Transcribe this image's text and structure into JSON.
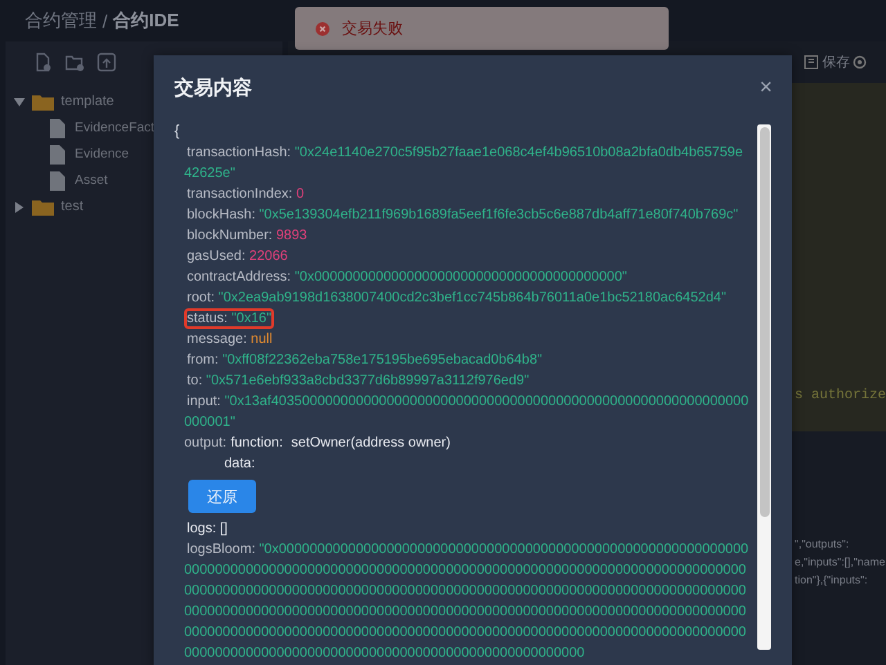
{
  "breadcrumb": {
    "items": [
      "合约管理",
      "合约IDE"
    ],
    "separator": "/"
  },
  "toast": {
    "kind": "error",
    "message": "交易失败"
  },
  "sidebar": {
    "tree": [
      {
        "label": "template",
        "kind": "folder",
        "expanded": true,
        "children": [
          {
            "label": "EvidenceFact",
            "kind": "file"
          },
          {
            "label": "Evidence",
            "kind": "file"
          },
          {
            "label": "Asset",
            "kind": "file"
          }
        ]
      },
      {
        "label": "test",
        "kind": "folder",
        "expanded": false
      }
    ]
  },
  "editor_toolbar": [
    {
      "label": "保存"
    }
  ],
  "editor": {
    "code_fragment": "s authorize"
  },
  "output_fragments": [
    "\",\"outputs\":",
    "e,\"inputs\":[],\"name",
    "tion\"},{\"inputs\":"
  ],
  "modal": {
    "title": "交易内容",
    "close": "×",
    "open_brace": "{",
    "fields": [
      {
        "key": "transactionHash:",
        "value": "\"0x24e1140e270c5f95b27faae1e068c4ef4b96510b08a2bfa0db4b65759e42625e\"",
        "kind": "string",
        "highlighted": false
      },
      {
        "key": "transactionIndex:",
        "value": "0",
        "kind": "number",
        "highlighted": false
      },
      {
        "key": "blockHash:",
        "value": "\"0x5e139304efb211f969b1689fa5eef1f6fe3cb5c6e887db4aff71e80f740b769c\"",
        "kind": "string",
        "highlighted": false
      },
      {
        "key": "blockNumber:",
        "value": "9893",
        "kind": "number",
        "highlighted": false
      },
      {
        "key": "gasUsed:",
        "value": "22066",
        "kind": "number",
        "highlighted": false
      },
      {
        "key": "contractAddress:",
        "value": "\"0x0000000000000000000000000000000000000000\"",
        "kind": "string",
        "highlighted": false
      },
      {
        "key": "root:",
        "value": "\"0x2ea9ab9198d1638007400cd2c3bef1cc745b864b76011a0e1bc52180ac6452d4\"",
        "kind": "string",
        "highlighted": false
      },
      {
        "key": "status:",
        "value": "\"0x16\"",
        "kind": "string",
        "highlighted": true
      },
      {
        "key": "message:",
        "value": "null",
        "kind": "null",
        "highlighted": false
      },
      {
        "key": "from:",
        "value": "\"0xff08f22362eba758e175195be695ebacad0b64b8\"",
        "kind": "string",
        "highlighted": false
      },
      {
        "key": "to:",
        "value": "\"0x571e6ebf933a8cbd3377d6b89997a3112f976ed9\"",
        "kind": "string",
        "highlighted": false
      },
      {
        "key": "input:",
        "value": "\"0x13af40350000000000000000000000000000000000000000000000000000000000000001\"",
        "kind": "string",
        "highlighted": false
      },
      {
        "key": "output:",
        "kind": "output",
        "function_label": "function:",
        "function": "setOwner(address owner)",
        "data_label": "data:",
        "button": "还原"
      },
      {
        "key": "logs:",
        "value": "[]",
        "kind": "plain",
        "highlighted": false
      },
      {
        "key": "logsBloom:",
        "value": "\"0x000000000000000000000000000000000000000000000000000000000000000000000000000000000000000000000000000000000000000000000000000000000000000000000000000000000000000000000000000000000000000000000000000000000000000000000000000000000000000000000000000000000000000000000000000000000000000000000000000000000000000000000000000000000000000000000000000000000000000000000000000000000000000000000000000000000000000000000",
        "kind": "string",
        "highlighted": false
      }
    ]
  }
}
